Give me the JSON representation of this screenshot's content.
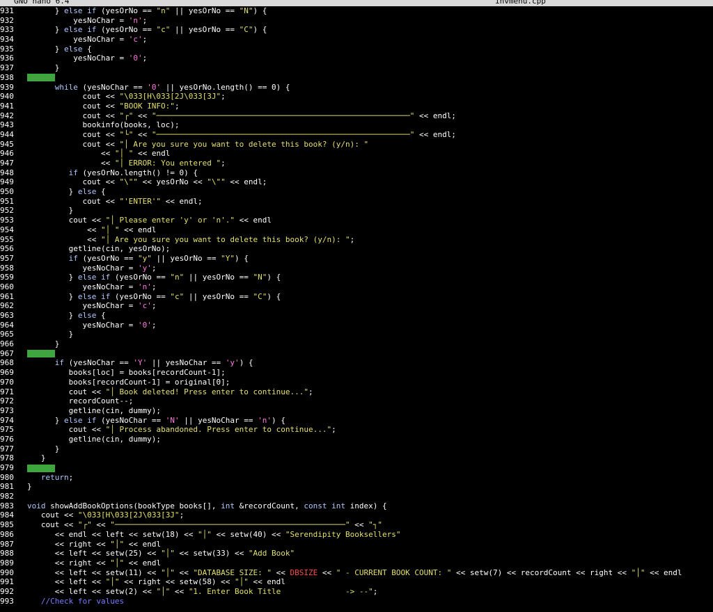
{
  "titlebar": {
    "app": "GNU nano 6.4",
    "file": "invmenu.cpp"
  },
  "lines": [
    {
      "n": "931",
      "c": "      } else if (yesOrNo == \"n\" || yesOrNo == \"N\") {"
    },
    {
      "n": "932",
      "c": "          yesNoChar = 'n';"
    },
    {
      "n": "933",
      "c": "      } else if (yesOrNo == \"c\" || yesOrNo == \"C\") {"
    },
    {
      "n": "934",
      "c": "          yesNoChar = 'c';"
    },
    {
      "n": "935",
      "c": "      } else {"
    },
    {
      "n": "936",
      "c": "          yesNoChar = '0';"
    },
    {
      "n": "937",
      "c": "      }"
    },
    {
      "n": "938",
      "c": "",
      "ws": true
    },
    {
      "n": "939",
      "c": "      while (yesNoChar == '0' || yesOrNo.length() == 0) {"
    },
    {
      "n": "940",
      "c": "            cout << \"\\033[H\\033[2J\\033[3J\";"
    },
    {
      "n": "941",
      "c": "            cout << \"BOOK INFO:\";"
    },
    {
      "n": "942",
      "c": "            cout << \"┌\" << \"───────────────────────────────────────────────────────\" << endl;"
    },
    {
      "n": "943",
      "c": "            bookinfo(books, loc);"
    },
    {
      "n": "944",
      "c": "            cout << \"└\" << \"───────────────────────────────────────────────────────\" << endl;"
    },
    {
      "n": "945",
      "c": "            cout << \"│ Are you sure you want to delete this book? (y/n): \""
    },
    {
      "n": "946",
      "c": "                << \"│ \" << endl"
    },
    {
      "n": "947",
      "c": "                << \"│ ERROR: You entered \";"
    },
    {
      "n": "948",
      "c": "         if (yesOrNo.length() != 0) {"
    },
    {
      "n": "949",
      "c": "            cout << \"\\\"\" << yesOrNo << \"\\\"\" << endl;"
    },
    {
      "n": "950",
      "c": "         } else {"
    },
    {
      "n": "951",
      "c": "            cout << \"'ENTER'\" << endl;"
    },
    {
      "n": "952",
      "c": "         }"
    },
    {
      "n": "953",
      "c": "         cout << \"│ Please enter 'y' or 'n'.\" << endl"
    },
    {
      "n": "954",
      "c": "             << \"│ \" << endl"
    },
    {
      "n": "955",
      "c": "             << \"│ Are you sure you want to delete this book? (y/n): \";"
    },
    {
      "n": "956",
      "c": "         getline(cin, yesOrNo);"
    },
    {
      "n": "957",
      "c": "         if (yesOrNo == \"y\" || yesOrNo == \"Y\") {"
    },
    {
      "n": "958",
      "c": "            yesNoChar = 'y';"
    },
    {
      "n": "959",
      "c": "         } else if (yesOrNo == \"n\" || yesOrNo == \"N\") {"
    },
    {
      "n": "960",
      "c": "            yesNoChar = 'n';"
    },
    {
      "n": "961",
      "c": "         } else if (yesOrNo == \"c\" || yesOrNo == \"C\") {"
    },
    {
      "n": "962",
      "c": "            yesNoChar = 'c';"
    },
    {
      "n": "963",
      "c": "         } else {"
    },
    {
      "n": "964",
      "c": "            yesNoChar = '0';"
    },
    {
      "n": "965",
      "c": "         }"
    },
    {
      "n": "966",
      "c": "      }"
    },
    {
      "n": "967",
      "c": "",
      "ws": true
    },
    {
      "n": "968",
      "c": "      if (yesNoChar == 'Y' || yesNoChar == 'y') {"
    },
    {
      "n": "969",
      "c": "         books[loc] = books[recordCount-1];"
    },
    {
      "n": "970",
      "c": "         books[recordCount-1] = original[0];"
    },
    {
      "n": "971",
      "c": "         cout << \"│ Book deleted! Press enter to continue...\";"
    },
    {
      "n": "972",
      "c": "         recordCount--;"
    },
    {
      "n": "973",
      "c": "         getline(cin, dummy);"
    },
    {
      "n": "974",
      "c": "      } else if (yesNoChar == 'N' || yesNoChar == 'n') {"
    },
    {
      "n": "975",
      "c": "         cout << \"│ Process abandoned. Press enter to continue...\";"
    },
    {
      "n": "976",
      "c": "         getline(cin, dummy);"
    },
    {
      "n": "977",
      "c": "      }"
    },
    {
      "n": "978",
      "c": "   }"
    },
    {
      "n": "979",
      "c": "",
      "ws": true
    },
    {
      "n": "980",
      "c": "   return;"
    },
    {
      "n": "981",
      "c": "}"
    },
    {
      "n": "982",
      "c": ""
    },
    {
      "n": "983",
      "c": "void showAddBookOptions(bookType books[], int &recordCount, const int index) {"
    },
    {
      "n": "984",
      "c": "   cout << \"\\033[H\\033[2J\\033[3J\";"
    },
    {
      "n": "985",
      "c": "   cout << \"┌\" << \"──────────────────────────────────────────────────\" << \"┐\""
    },
    {
      "n": "986",
      "c": "      << endl << left << setw(18) << \"│\" << setw(40) << \"Serendipity Booksellers\""
    },
    {
      "n": "987",
      "c": "      << right << \"│\" << endl"
    },
    {
      "n": "988",
      "c": "      << left << setw(25) << \"│\" << setw(33) << \"Add Book\""
    },
    {
      "n": "989",
      "c": "      << right << \"│\" << endl"
    },
    {
      "n": "990",
      "c": "      << left << setw(11) << \"│\" << \"DATABASE SIZE: \" << DBSIZE << \" - CURRENT BOOK COUNT: \" << setw(7) << recordCount << right << \"│\" << endl"
    },
    {
      "n": "991",
      "c": "      << left << \"│\" << right << setw(58) << \"│\" << endl"
    },
    {
      "n": "992",
      "c": "      << left << setw(2) << \"│\" << \"1. Enter Book Title              -> --\";"
    },
    {
      "n": "993",
      "c": "   //Check for values"
    }
  ]
}
